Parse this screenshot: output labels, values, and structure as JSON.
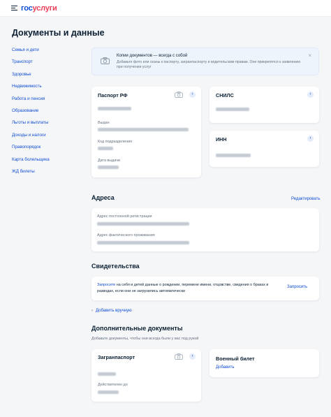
{
  "header": {
    "logo_part1": "гос",
    "logo_part2": "услуги"
  },
  "page": {
    "title": "Документы и данные"
  },
  "sidebar": {
    "items": [
      {
        "label": "Семья и дети"
      },
      {
        "label": "Транспорт"
      },
      {
        "label": "Здоровье"
      },
      {
        "label": "Недвижимость"
      },
      {
        "label": "Работа и пенсия"
      },
      {
        "label": "Образование"
      },
      {
        "label": "Льготы и выплаты"
      },
      {
        "label": "Доходы и налоги"
      },
      {
        "label": "Правопорядок"
      },
      {
        "label": "Карта болельщика"
      },
      {
        "label": "ЖД билеты"
      }
    ]
  },
  "banner": {
    "title": "Копии документов — всегда с собой",
    "text": "Добавьте фото или сканы к паспорту, загранпаспорту и водительским правам. Они прикрепятся к заявлению при получении услуг",
    "close_glyph": "×"
  },
  "passport": {
    "title": "Паспорт РФ",
    "fields": [
      {
        "label": "Выдан"
      },
      {
        "label": "Код подразделения"
      },
      {
        "label": "Дата выдачи"
      }
    ]
  },
  "snils": {
    "title": "СНИЛС"
  },
  "inn": {
    "title": "ИНН"
  },
  "addresses": {
    "title": "Адреса",
    "edit_label": "Редактировать",
    "fields": [
      {
        "label": "Адрес постоянной регистрации"
      },
      {
        "label": "Адрес фактического проживания"
      }
    ]
  },
  "certificates": {
    "title": "Свидетельства",
    "request_link": "Запросите",
    "request_text": " на себя и детей данные о рождении, перемене имени, отцовстве, сведения о браках и разводах, если они не загрузились автоматически",
    "request_button": "Запросить",
    "add_manual": "Добавить вручную"
  },
  "additional": {
    "title": "Дополнительные документы",
    "subtitle": "Добавьте документы, чтобы они всегда были у вас под рукой",
    "zagran": {
      "title": "Загранпаспорт",
      "valid_label": "Действителен до"
    },
    "military": {
      "title": "Военный билет",
      "add_label": "Добавить"
    }
  },
  "icons": {
    "arrow": "›",
    "chevron": "›"
  },
  "colors": {
    "accent": "#0d4cd3",
    "brand_red": "#ee3f58",
    "text": "#0b1f33",
    "muted": "#66727f",
    "background": "#f5f6f8"
  }
}
